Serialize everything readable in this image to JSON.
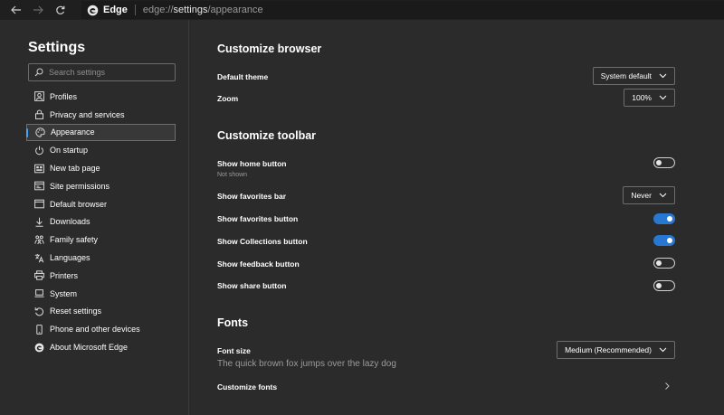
{
  "browser": {
    "site_name": "Edge",
    "url_prefix": "edge://",
    "url_path": "settings",
    "url_suffix": "/appearance"
  },
  "sidebar": {
    "title": "Settings",
    "search_placeholder": "Search settings",
    "items": [
      {
        "label": "Profiles",
        "icon": "profile-icon"
      },
      {
        "label": "Privacy and services",
        "icon": "lock-icon"
      },
      {
        "label": "Appearance",
        "icon": "palette-icon",
        "active": true
      },
      {
        "label": "On startup",
        "icon": "power-icon"
      },
      {
        "label": "New tab page",
        "icon": "new-tab-icon"
      },
      {
        "label": "Site permissions",
        "icon": "site-permissions-icon"
      },
      {
        "label": "Default browser",
        "icon": "browser-icon"
      },
      {
        "label": "Downloads",
        "icon": "download-icon"
      },
      {
        "label": "Family safety",
        "icon": "family-icon"
      },
      {
        "label": "Languages",
        "icon": "languages-icon"
      },
      {
        "label": "Printers",
        "icon": "printer-icon"
      },
      {
        "label": "System",
        "icon": "system-icon"
      },
      {
        "label": "Reset settings",
        "icon": "reset-icon"
      },
      {
        "label": "Phone and other devices",
        "icon": "phone-icon"
      },
      {
        "label": "About Microsoft Edge",
        "icon": "edge-icon"
      }
    ]
  },
  "main": {
    "customize_browser": {
      "title": "Customize browser",
      "default_theme_label": "Default theme",
      "default_theme_value": "System default",
      "zoom_label": "Zoom",
      "zoom_value": "100%"
    },
    "customize_toolbar": {
      "title": "Customize toolbar",
      "home_button_label": "Show home button",
      "home_button_sub": "Not shown",
      "home_button_on": false,
      "favorites_bar_label": "Show favorites bar",
      "favorites_bar_value": "Never",
      "favorites_button_label": "Show favorites button",
      "favorites_button_on": true,
      "collections_button_label": "Show Collections button",
      "collections_button_on": true,
      "feedback_button_label": "Show feedback button",
      "feedback_button_on": false,
      "share_button_label": "Show share button",
      "share_button_on": false
    },
    "fonts": {
      "title": "Fonts",
      "font_size_label": "Font size",
      "font_size_value": "Medium (Recommended)",
      "sample_text": "The quick brown fox jumps over the lazy dog",
      "customize_fonts_label": "Customize fonts"
    }
  },
  "colors": {
    "accent": "#2878d2",
    "active_marker": "#4aa3f4",
    "background": "#2b2b2b"
  }
}
